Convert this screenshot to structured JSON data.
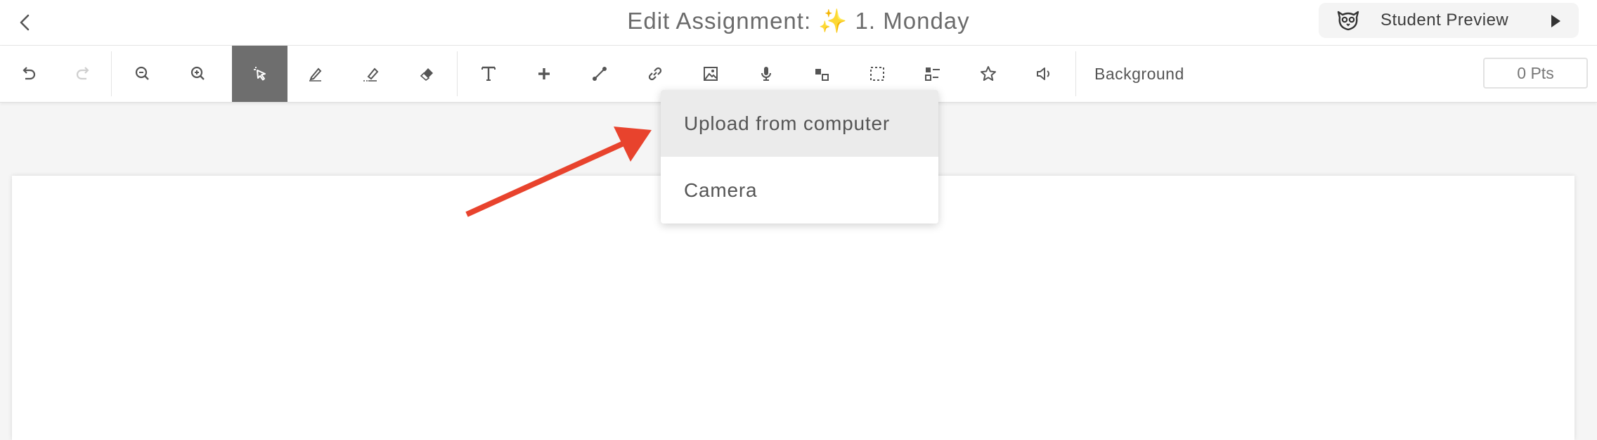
{
  "header": {
    "title_prefix": "Edit Assignment: ",
    "sparkle": "✨",
    "title_name": " 1. Monday",
    "preview_label": "Student Preview"
  },
  "toolbar": {
    "tools": [
      "undo-icon",
      "redo-icon",
      "zoom-out-icon",
      "zoom-in-icon",
      "select-cursor-icon",
      "pen-icon",
      "highlighter-icon",
      "eraser-icon",
      "text-icon",
      "plus-icon",
      "line-icon",
      "link-icon",
      "image-icon",
      "microphone-icon",
      "shapes-icon",
      "selection-box-icon",
      "checklist-icon",
      "star-icon",
      "speaker-icon"
    ],
    "active_tool": "select-cursor-icon",
    "background_label": "Background",
    "points_value": "0 Pts"
  },
  "image_menu": {
    "items": [
      {
        "label": "Upload from computer",
        "highlighted": true
      },
      {
        "label": "Camera",
        "highlighted": false
      }
    ]
  },
  "annotation": {
    "arrow_color": "#e8432d"
  }
}
